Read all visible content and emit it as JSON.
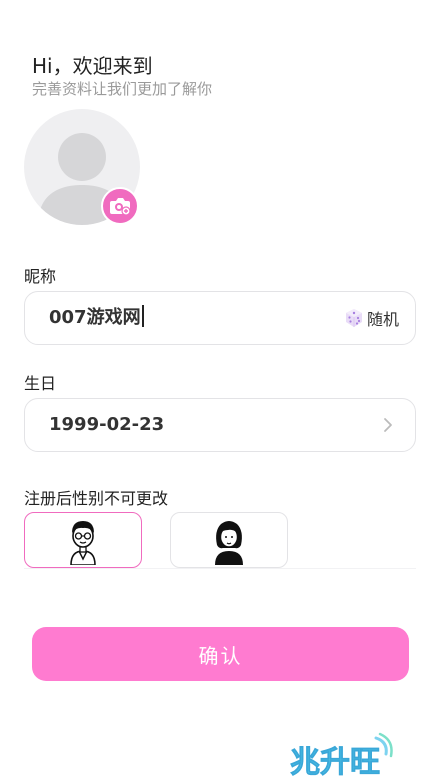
{
  "header": {
    "title": "Hi，欢迎来到",
    "subtitle": "完善资料让我们更加了解你"
  },
  "avatar": {
    "badge_icon": "camera-plus-icon",
    "accent": "#f06bbf"
  },
  "nickname": {
    "label": "昵称",
    "value": "007游戏网",
    "random_label": "随机",
    "random_icon": "dice-icon"
  },
  "birthday": {
    "label": "生日",
    "value": "1999-02-23",
    "chevron_icon": "chevron-right-icon"
  },
  "gender": {
    "label": "注册后性别不可更改",
    "options": [
      {
        "id": "male",
        "icon": "male-avatar-icon",
        "selected": true
      },
      {
        "id": "female",
        "icon": "female-avatar-icon",
        "selected": false
      }
    ]
  },
  "confirm": {
    "label": "确认",
    "color": "#ff7bd0"
  },
  "watermark": {
    "text": "兆升旺"
  }
}
